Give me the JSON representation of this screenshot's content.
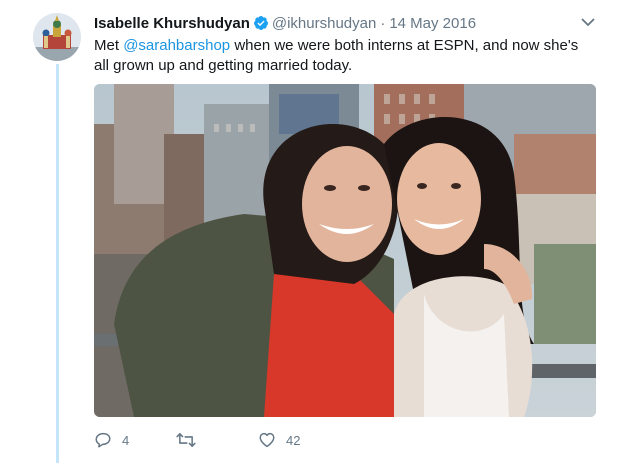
{
  "tweet": {
    "author_name": "Isabelle Khurshudyan",
    "handle": "@ikhurshudyan",
    "separator": "·",
    "date": "14 May 2016",
    "text_before": "Met ",
    "mention": "@sarahbarshop",
    "text_after": " when we were both interns at ESPN, and now she's all grown up and getting married today."
  },
  "actions": {
    "reply_count": "4",
    "retweet_count": "",
    "like_count": "42"
  },
  "icons": {
    "verified": "verified-badge-icon",
    "caret": "chevron-down-icon",
    "reply": "reply-icon",
    "retweet": "retweet-icon",
    "like": "heart-icon"
  },
  "colors": {
    "accent": "#1b95e0",
    "thread_line": "#c4e5fa",
    "muted_text": "#657786",
    "primary_text": "#14171a"
  }
}
